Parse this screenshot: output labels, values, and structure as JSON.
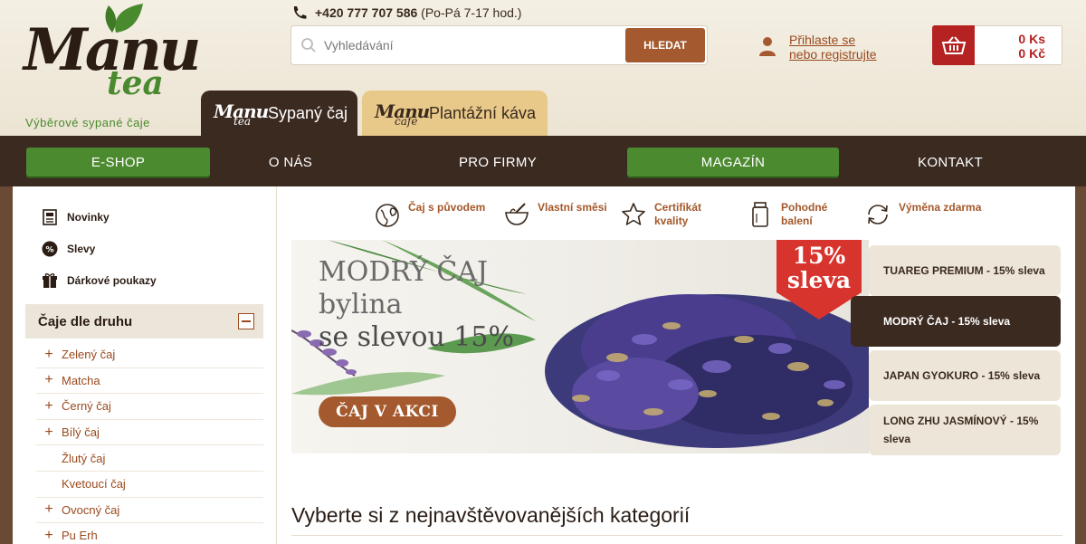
{
  "brand": {
    "logo_main": "Manu",
    "logo_sub": "tea",
    "tagline": "Výběrové sypané čaje"
  },
  "header": {
    "phone_number": "+420 777 707 586",
    "phone_hours": "(Po-Pá 7-17 hod.)",
    "search_placeholder": "Vyhledávání",
    "search_button": "HLEDAT",
    "login_line1": "Přihlaste se",
    "login_line2": "nebo registrujte",
    "cart_ks": "0 Ks",
    "cart_price": "0 Kč"
  },
  "tabs": [
    {
      "logo_main": "Manu",
      "logo_sub": "tea",
      "label": "Sypaný čaj"
    },
    {
      "logo_main": "Manu",
      "logo_sub": "cafe",
      "label": "Plantážní káva"
    }
  ],
  "nav": [
    "E-SHOP",
    "O NÁS",
    "PRO FIRMY",
    "MAGAZÍN",
    "KONTAKT"
  ],
  "sidebar": {
    "quick_links": [
      "Novinky",
      "Slevy",
      "Dárkové poukazy"
    ],
    "sleva_icon_text": "%",
    "category_title": "Čaje dle druhu",
    "categories": [
      {
        "label": "Zelený čaj",
        "expandable": true
      },
      {
        "label": "Matcha",
        "expandable": true
      },
      {
        "label": "Černý čaj",
        "expandable": true
      },
      {
        "label": "Bílý čaj",
        "expandable": true
      },
      {
        "label": "Žlutý čaj",
        "expandable": false
      },
      {
        "label": "Kvetoucí čaj",
        "expandable": false
      },
      {
        "label": "Ovocný čaj",
        "expandable": true
      },
      {
        "label": "Pu Erh",
        "expandable": true
      }
    ]
  },
  "features": [
    {
      "line1": "Čaj s původem",
      "line2": "",
      "icon": "globe-leaf-icon"
    },
    {
      "line1": "Vlastní směsi",
      "line2": "",
      "icon": "mortar-icon"
    },
    {
      "line1": "Certifikát",
      "line2": "kvality",
      "icon": "star-icon"
    },
    {
      "line1": "Pohodné",
      "line2": "balení",
      "icon": "package-icon"
    },
    {
      "line1": "Výměna zdarma",
      "line2": "",
      "icon": "exchange-icon"
    }
  ],
  "banner": {
    "line1": "MODRÝ ČAJ",
    "line2": "bylina",
    "line3": "se slevou 15%",
    "button": "ČAJ V AKCI",
    "badge_line1": "15%",
    "badge_line2": "sleva"
  },
  "slider_tabs": [
    {
      "label": "TUAREG PREMIUM - 15% sleva",
      "active": false
    },
    {
      "label": "MODRÝ ČAJ - 15% sleva",
      "active": true
    },
    {
      "label": "JAPAN GYOKURO - 15% sleva",
      "active": false
    },
    {
      "label": "LONG ZHU JASMÍNOVÝ - 15% sleva",
      "active": false
    }
  ],
  "section_title": "Vyberte si z nejnavštěvovanějších kategorií",
  "colors": {
    "brown_dark": "#3b2a20",
    "green": "#4c8a30",
    "rust": "#a45a2e",
    "red": "#b52222",
    "cream": "#efe9dc"
  }
}
